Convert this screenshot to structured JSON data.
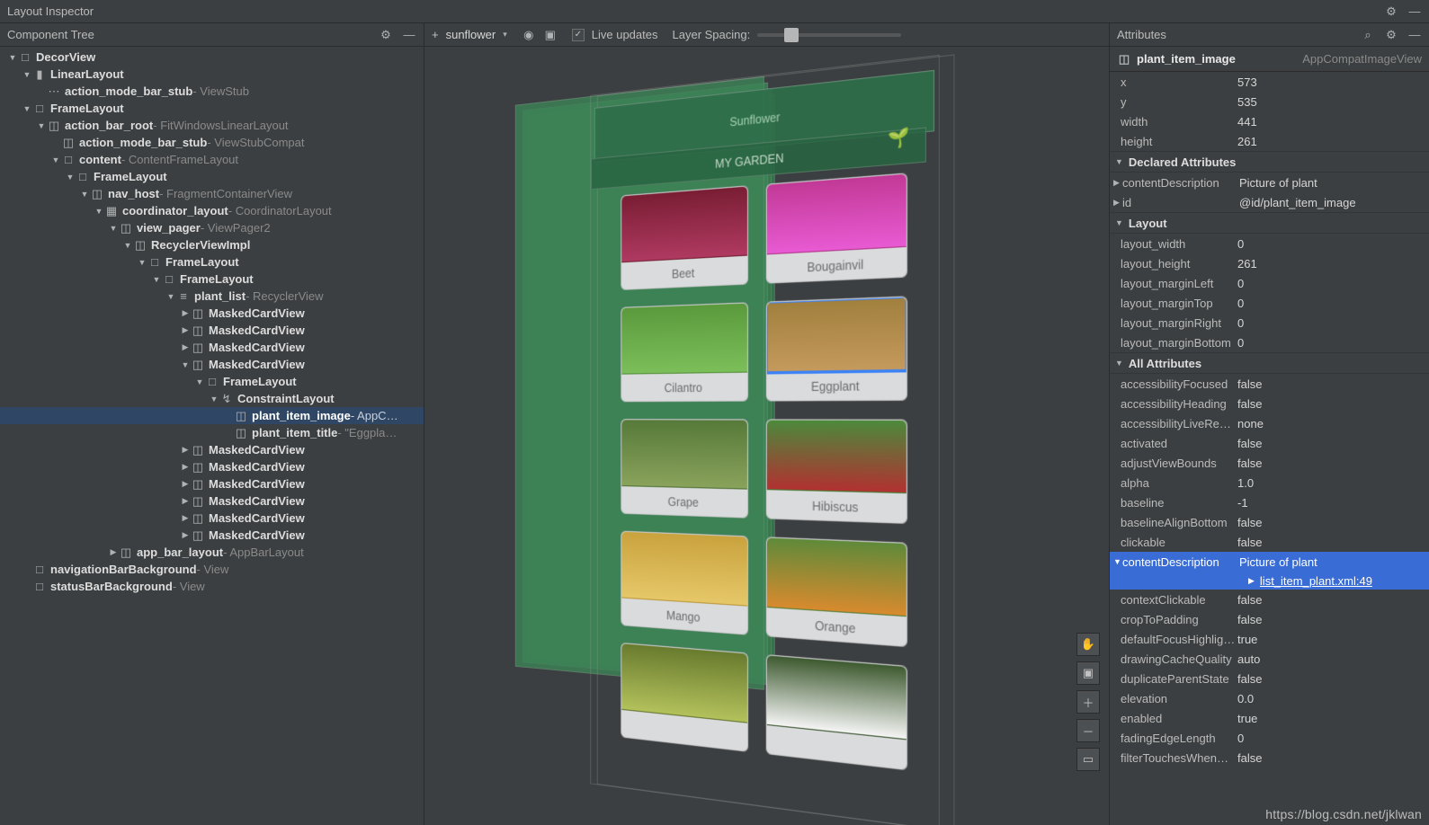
{
  "titleBar": {
    "title": "Layout Inspector"
  },
  "leftPanel": {
    "title": "Component Tree"
  },
  "centerToolbar": {
    "processPrefix": "+",
    "process": "sunflower",
    "liveUpdates": "Live updates",
    "layerSpacing": "Layer Spacing:"
  },
  "tree": [
    {
      "d": 0,
      "a": "▼",
      "i": "□",
      "n": "DecorView",
      "t": ""
    },
    {
      "d": 1,
      "a": "▼",
      "i": "▮",
      "n": "LinearLayout",
      "t": ""
    },
    {
      "d": 2,
      "a": "",
      "i": "⋯",
      "n": "action_mode_bar_stub",
      "t": " - ViewStub"
    },
    {
      "d": 1,
      "a": "▼",
      "i": "□",
      "n": "FrameLayout",
      "t": ""
    },
    {
      "d": 2,
      "a": "▼",
      "i": "◫",
      "n": "action_bar_root",
      "t": " - FitWindowsLinearLayout"
    },
    {
      "d": 3,
      "a": "",
      "i": "◫",
      "n": "action_mode_bar_stub",
      "t": " - ViewStubCompat"
    },
    {
      "d": 3,
      "a": "▼",
      "i": "□",
      "n": "content",
      "t": " - ContentFrameLayout"
    },
    {
      "d": 4,
      "a": "▼",
      "i": "□",
      "n": "FrameLayout",
      "t": ""
    },
    {
      "d": 5,
      "a": "▼",
      "i": "◫",
      "n": "nav_host",
      "t": " - FragmentContainerView"
    },
    {
      "d": 6,
      "a": "▼",
      "i": "▦",
      "n": "coordinator_layout",
      "t": " - CoordinatorLayout"
    },
    {
      "d": 7,
      "a": "▼",
      "i": "◫",
      "n": "view_pager",
      "t": " - ViewPager2"
    },
    {
      "d": 8,
      "a": "▼",
      "i": "◫",
      "n": "RecyclerViewImpl",
      "t": ""
    },
    {
      "d": 9,
      "a": "▼",
      "i": "□",
      "n": "FrameLayout",
      "t": ""
    },
    {
      "d": 10,
      "a": "▼",
      "i": "□",
      "n": "FrameLayout",
      "t": ""
    },
    {
      "d": 11,
      "a": "▼",
      "i": "≡",
      "n": "plant_list",
      "t": " - RecyclerView"
    },
    {
      "d": 12,
      "a": "▶",
      "i": "◫",
      "n": "MaskedCardView",
      "t": ""
    },
    {
      "d": 12,
      "a": "▶",
      "i": "◫",
      "n": "MaskedCardView",
      "t": ""
    },
    {
      "d": 12,
      "a": "▶",
      "i": "◫",
      "n": "MaskedCardView",
      "t": ""
    },
    {
      "d": 12,
      "a": "▼",
      "i": "◫",
      "n": "MaskedCardView",
      "t": ""
    },
    {
      "d": 13,
      "a": "▼",
      "i": "□",
      "n": "FrameLayout",
      "t": ""
    },
    {
      "d": 14,
      "a": "▼",
      "i": "↯",
      "n": "ConstraintLayout",
      "t": ""
    },
    {
      "d": 15,
      "a": "",
      "i": "◫",
      "n": "plant_item_image",
      "t": " - AppC…",
      "sel": true
    },
    {
      "d": 15,
      "a": "",
      "i": "◫",
      "n": "plant_item_title",
      "t": " - \"Eggpla…"
    },
    {
      "d": 12,
      "a": "▶",
      "i": "◫",
      "n": "MaskedCardView",
      "t": ""
    },
    {
      "d": 12,
      "a": "▶",
      "i": "◫",
      "n": "MaskedCardView",
      "t": ""
    },
    {
      "d": 12,
      "a": "▶",
      "i": "◫",
      "n": "MaskedCardView",
      "t": ""
    },
    {
      "d": 12,
      "a": "▶",
      "i": "◫",
      "n": "MaskedCardView",
      "t": ""
    },
    {
      "d": 12,
      "a": "▶",
      "i": "◫",
      "n": "MaskedCardView",
      "t": ""
    },
    {
      "d": 12,
      "a": "▶",
      "i": "◫",
      "n": "MaskedCardView",
      "t": ""
    },
    {
      "d": 7,
      "a": "▶",
      "i": "◫",
      "n": "app_bar_layout",
      "t": " - AppBarLayout"
    },
    {
      "d": 1,
      "a": "",
      "i": "□",
      "n": "navigationBarBackground",
      "t": " - View"
    },
    {
      "d": 1,
      "a": "",
      "i": "□",
      "n": "statusBarBackground",
      "t": " - View"
    }
  ],
  "canvas": {
    "banner": "Sunflower",
    "headerTab": "MY GARDEN",
    "selectedTooltip": "AppCompatImageView",
    "cards": [
      [
        "Beet",
        "Bougainvil"
      ],
      [
        "Cilantro",
        "Eggplant"
      ],
      [
        "Grape",
        "Hibiscus"
      ],
      [
        "Mango",
        "Orange"
      ],
      [
        "",
        ""
      ]
    ]
  },
  "rightPanel": {
    "title": "Attributes",
    "selectedName": "plant_item_image",
    "selectedType": "AppCompatImageView",
    "basic": {
      "x": "573",
      "y": "535",
      "width": "441",
      "height": "261"
    },
    "sections": {
      "declared": "Declared Attributes",
      "layout": "Layout",
      "all": "All Attributes"
    },
    "declared": [
      {
        "k": "contentDescription",
        "v": "Picture of plant",
        "expand": true
      },
      {
        "k": "id",
        "v": "@id/plant_item_image",
        "expand": true
      }
    ],
    "layout": [
      {
        "k": "layout_width",
        "v": "0"
      },
      {
        "k": "layout_height",
        "v": "261"
      },
      {
        "k": "layout_marginLeft",
        "v": "0"
      },
      {
        "k": "layout_marginTop",
        "v": "0"
      },
      {
        "k": "layout_marginRight",
        "v": "0"
      },
      {
        "k": "layout_marginBottom",
        "v": "0"
      }
    ],
    "all": [
      {
        "k": "accessibilityFocused",
        "v": "false"
      },
      {
        "k": "accessibilityHeading",
        "v": "false"
      },
      {
        "k": "accessibilityLiveRegion",
        "v": "none"
      },
      {
        "k": "activated",
        "v": "false"
      },
      {
        "k": "adjustViewBounds",
        "v": "false"
      },
      {
        "k": "alpha",
        "v": "1.0"
      },
      {
        "k": "baseline",
        "v": "-1"
      },
      {
        "k": "baselineAlignBottom",
        "v": "false"
      },
      {
        "k": "clickable",
        "v": "false"
      },
      {
        "k": "contentDescription",
        "v": "Picture of plant",
        "hl": true,
        "sub": "list_item_plant.xml:49"
      },
      {
        "k": "contextClickable",
        "v": "false"
      },
      {
        "k": "cropToPadding",
        "v": "false"
      },
      {
        "k": "defaultFocusHighlight…",
        "v": "true"
      },
      {
        "k": "drawingCacheQuality",
        "v": "auto"
      },
      {
        "k": "duplicateParentState",
        "v": "false"
      },
      {
        "k": "elevation",
        "v": "0.0"
      },
      {
        "k": "enabled",
        "v": "true"
      },
      {
        "k": "fadingEdgeLength",
        "v": "0"
      },
      {
        "k": "filterTouchesWhenOb…",
        "v": "false"
      }
    ]
  },
  "watermark": "https://blog.csdn.net/jklwan"
}
